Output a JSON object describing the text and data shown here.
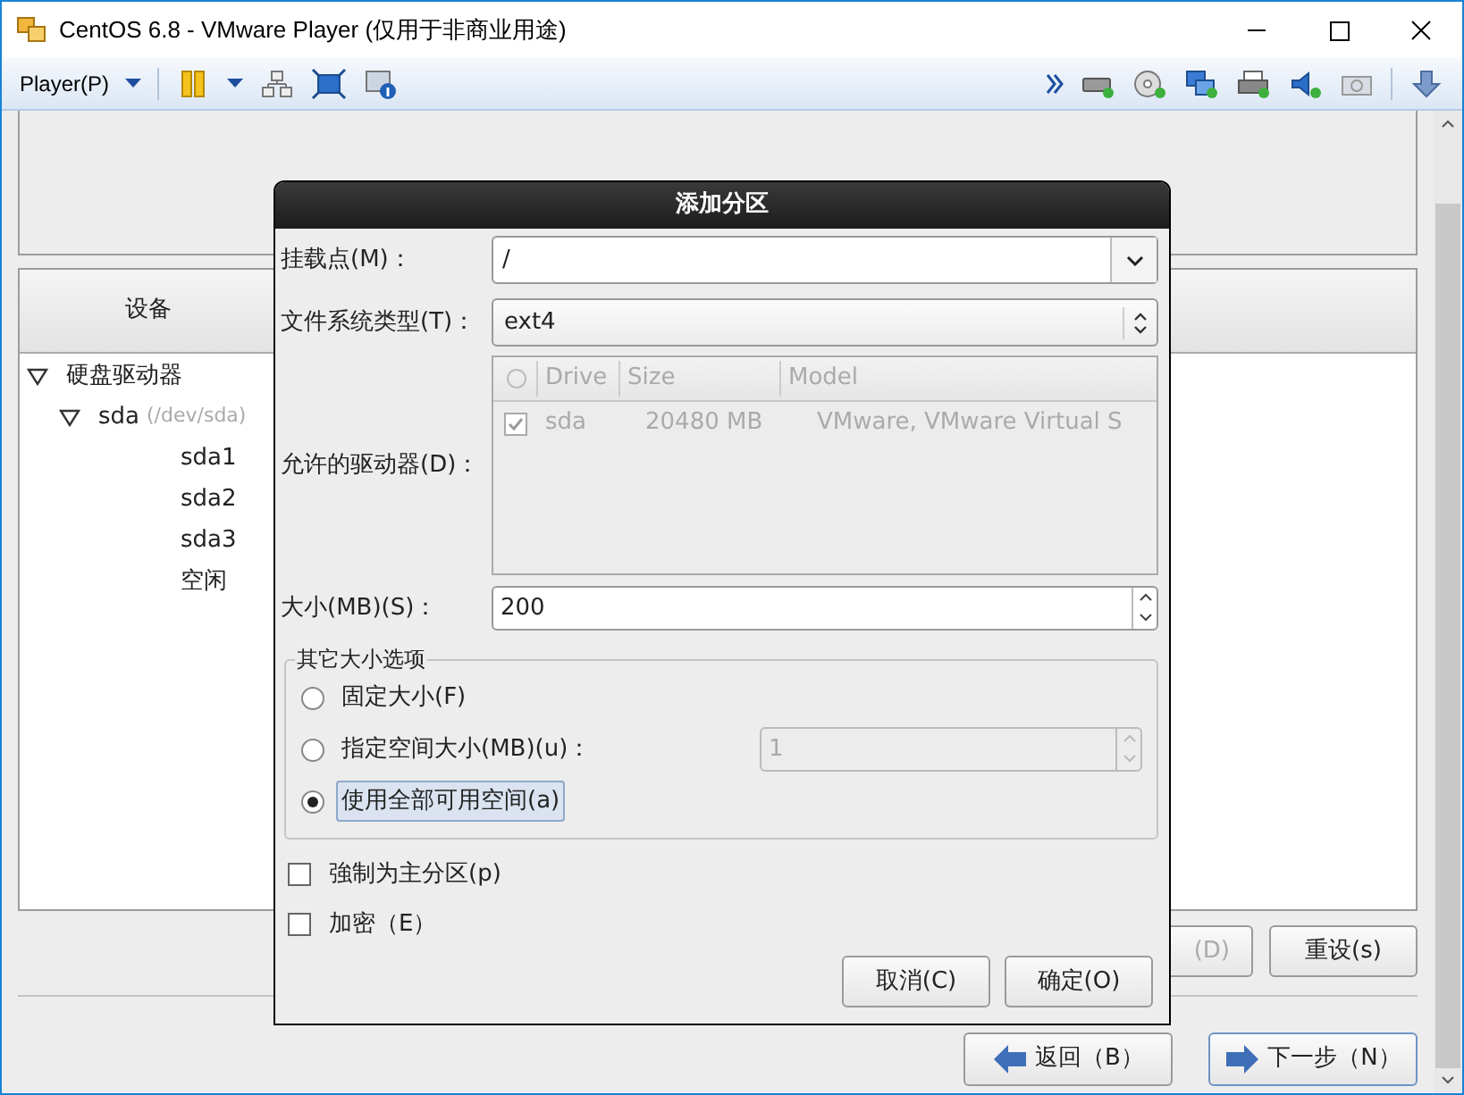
{
  "window": {
    "title": "CentOS 6.8 - VMware Player (仅用于非商业用途)"
  },
  "toolbar": {
    "player_menu": "Player(P)"
  },
  "installer": {
    "tree": {
      "column": "设备",
      "items": [
        {
          "label": "硬盘驱动器",
          "expanded": true,
          "children": [
            {
              "label": "sda",
              "detail": "(/dev/sda)",
              "expanded": true,
              "children": [
                {
                  "label": "sda1"
                },
                {
                  "label": "sda2"
                },
                {
                  "label": "sda3"
                },
                {
                  "label": "空闲"
                }
              ]
            }
          ]
        }
      ]
    },
    "buttons": [
      {
        "label": "(D)"
      },
      {
        "label": "重设(s)"
      }
    ],
    "nav": [
      {
        "label": "返回（B）",
        "kind": "back"
      },
      {
        "label": "下一步（N）",
        "kind": "next"
      }
    ]
  },
  "dialog": {
    "title": "添加分区",
    "mount_point": {
      "label": "挂载点(M)：",
      "value": "/"
    },
    "fs_type": {
      "label": "文件系统类型(T)：",
      "value": "ext4"
    },
    "drives": {
      "label": "允许的驱动器(D)：",
      "disabled": true,
      "columns": [
        "Drive",
        "Size",
        "Model"
      ],
      "rows": [
        {
          "checked": true,
          "cells": [
            "sda",
            "20480 MB",
            "VMware, VMware Virtual S"
          ]
        }
      ]
    },
    "size": {
      "label": "大小(MB)(S)：",
      "value": "200"
    },
    "other_sizes": {
      "legend": "其它大小选项",
      "options": [
        {
          "label": "固定大小(F)",
          "selected": false,
          "kind": "plain"
        },
        {
          "label": "指定空间大小(MB)(u)：",
          "selected": false,
          "kind": "spin",
          "value": "1",
          "disabled": true
        },
        {
          "label": "使用全部可用空间(a)",
          "selected": true,
          "kind": "plain",
          "focused": true
        }
      ]
    },
    "checkboxes": [
      {
        "label": "強制为主分区(p)",
        "checked": false
      },
      {
        "label": "加密（E）",
        "checked": false
      }
    ],
    "buttons": [
      "取消(C)",
      "确定(O)"
    ]
  }
}
